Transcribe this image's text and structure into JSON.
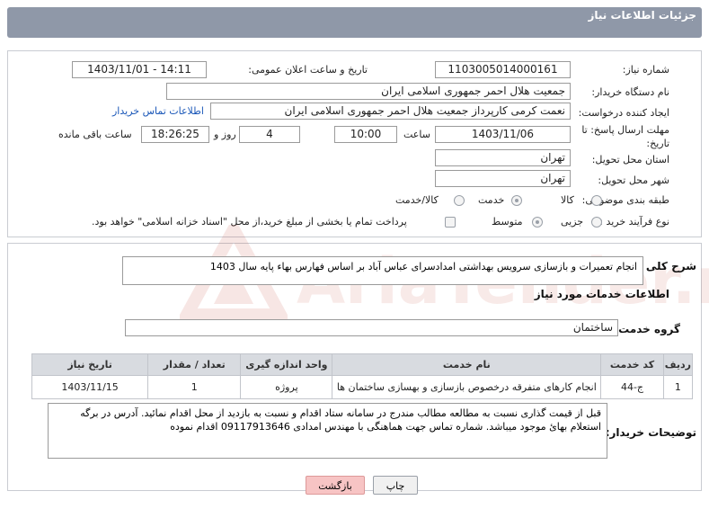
{
  "header": {
    "title": "جزئیات اطلاعات نیاز"
  },
  "fields": {
    "need_number_label": "شماره نیاز:",
    "need_number": "1103005014000161",
    "announce_label": "تاریخ و ساعت اعلان عمومی:",
    "announce_value": "1403/11/01 - 14:11",
    "buyer_org_label": "نام دستگاه خریدار:",
    "buyer_org": "جمعیت هلال احمر جمهوری اسلامی ایران",
    "requester_label": "ایجاد کننده درخواست:",
    "requester": "نعمت کرمی کارپرداز جمعیت هلال احمر جمهوری اسلامی ایران",
    "buyer_contact_link": "اطلاعات تماس خریدار",
    "deadline_label": "مهلت ارسال پاسخ: تا تاریخ:",
    "deadline_date": "1403/11/06",
    "time_label": "ساعت",
    "deadline_time": "10:00",
    "days_value": "4",
    "days_label": "روز و",
    "remaining_time": "18:26:25",
    "remaining_label": "ساعت باقی مانده",
    "province_label": "استان محل تحویل:",
    "province": "تهران",
    "city_label": "شهر محل تحویل:",
    "city": "تهران",
    "category_label": "طبقه بندی موضوعی:",
    "category_options": [
      "کالا",
      "خدمت",
      "کالا/خدمت"
    ],
    "process_label": "نوع فرآیند خرید :",
    "process_options": [
      "جزیی",
      "متوسط"
    ],
    "payment_note": "پرداخت تمام یا بخشی از مبلغ خرید،از محل \"اسناد خزانه اسلامی\" خواهد بود."
  },
  "summary": {
    "label": "شرح کلی نیاز:",
    "text": "انجام تعمیرات و بازسازی سرویس بهداشتی امدادسرای عباس آباد بر اساس فهارس بهاء پایه سال 1403"
  },
  "services": {
    "section_title": "اطلاعات خدمات مورد نیاز",
    "group_label": "گروه خدمت:",
    "group_value": "ساختمان",
    "columns": [
      "ردیف",
      "کد خدمت",
      "نام خدمت",
      "واحد اندازه گیری",
      "تعداد / مقدار",
      "تاریخ نیاز"
    ],
    "rows": [
      [
        "1",
        "ج-44",
        "انجام کارهای متفرقه درخصوص بازسازی و بهسازی ساختمان ها",
        "پروژه",
        "1",
        "1403/11/15"
      ]
    ]
  },
  "buyer_notes": {
    "label": "توضیحات خریدار:",
    "text": "قبل از قیمت گذاری نسبت به مطالعه مطالب مندرج در سامانه ستاد اقدام و نسبت به بازدید از محل اقدام نمائید. آدرس در برگه استعلام بهائ موجود میباشد. شماره تماس جهت هماهنگی با مهندس امدادی 09117913646 اقدام نموده"
  },
  "buttons": {
    "print": "چاپ",
    "back": "بازگشت"
  },
  "watermark": {
    "text": "AriaTender.neT"
  },
  "colors": {
    "header_bg": "#8f98a8",
    "link": "#1a57b8",
    "back_button": "#f7c4c4"
  }
}
